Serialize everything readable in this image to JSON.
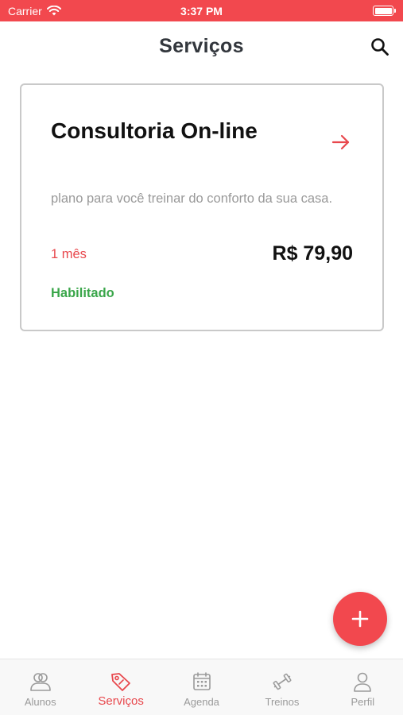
{
  "status_bar": {
    "carrier": "Carrier",
    "time": "3:37 PM"
  },
  "header": {
    "title": "Serviços"
  },
  "service_card": {
    "title": "Consultoria On-line",
    "description": "plano para você treinar do conforto da sua casa.",
    "duration": "1 mês",
    "price": "R$ 79,90",
    "status": "Habilitado"
  },
  "tab_bar": {
    "items": [
      {
        "label": "Alunos",
        "icon": "users-icon",
        "active": false
      },
      {
        "label": "Serviços",
        "icon": "tag-icon",
        "active": true
      },
      {
        "label": "Agenda",
        "icon": "calendar-icon",
        "active": false
      },
      {
        "label": "Treinos",
        "icon": "dumbbell-icon",
        "active": false
      },
      {
        "label": "Perfil",
        "icon": "person-icon",
        "active": false
      }
    ]
  },
  "colors": {
    "accent": "#f2484e",
    "enabled_green": "#3aa64a",
    "muted_text": "#999999",
    "title_text": "#33373d"
  }
}
